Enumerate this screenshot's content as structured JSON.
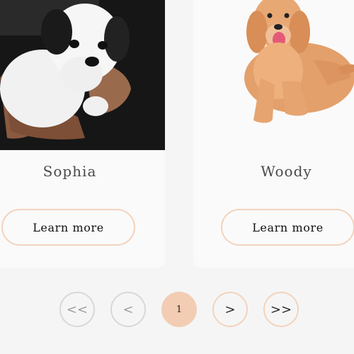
{
  "cards": [
    {
      "name": "Sophia",
      "button_label": "Learn more",
      "image_icon": "puppy-photo"
    },
    {
      "name": "Woody",
      "button_label": "Learn more",
      "image_icon": "golden-retriever-photo"
    }
  ],
  "pagination": {
    "first_label": "<<",
    "prev_label": "<",
    "current_page": "1",
    "next_label": ">",
    "last_label": ">>"
  },
  "colors": {
    "accent": "#f2cdb4",
    "accent_border": "#f2d3bd",
    "page_bg": "#f5f5f5",
    "card_bg": "#fafafa",
    "disabled": "#d8d8d8"
  }
}
